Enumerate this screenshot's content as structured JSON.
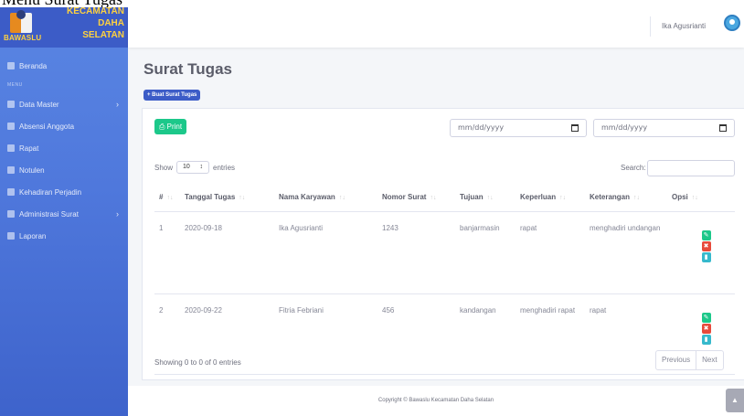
{
  "caption": "Menu Surat Tugas",
  "brand": {
    "line1": "KECAMATAN",
    "line2": "DAHA",
    "line3": "SELATAN",
    "org": "BAWASLU"
  },
  "sidebar": {
    "items": [
      {
        "label": "Beranda"
      },
      {
        "heading": "MENU"
      },
      {
        "label": "Data Master",
        "chevron": "›"
      },
      {
        "label": "Absensi Anggota"
      },
      {
        "label": "Rapat"
      },
      {
        "label": "Notulen"
      },
      {
        "label": "Kehadiran Perjadin"
      },
      {
        "label": "Administrasi Surat",
        "chevron": "›"
      },
      {
        "label": "Laporan"
      }
    ]
  },
  "topbar": {
    "user_name": "Ika Agusrianti"
  },
  "page": {
    "title": "Surat Tugas",
    "create_button": "+ Buat Surat Tugas"
  },
  "toolbar": {
    "print_label": "Print",
    "date_from_placeholder": "mm/dd/yyyy",
    "date_to_placeholder": "mm/dd/yyyy"
  },
  "table_controls": {
    "show_label": "Show",
    "entries_value": "10",
    "entries_label": "entries",
    "search_label": "Search:"
  },
  "table": {
    "headers": [
      "#",
      "Tanggal Tugas",
      "Nama Karyawan",
      "Nomor Surat",
      "Tujuan",
      "Keperluan",
      "Keterangan",
      "Opsi"
    ],
    "rows": [
      {
        "no": "1",
        "tanggal": "2020-09-18",
        "nama": "Ika Agusrianti",
        "nomor": "1243",
        "tujuan": "banjarmasin",
        "keperluan": "rapat",
        "keterangan": "menghadiri undangan"
      },
      {
        "no": "2",
        "tanggal": "2020-09-22",
        "nama": "Fitria Febriani",
        "nomor": "456",
        "tujuan": "kandangan",
        "keperluan": "menghadiri rapat",
        "keterangan": "rapat"
      }
    ]
  },
  "pagination": {
    "info": "Showing 0 to 0 of 0 entries",
    "previous": "Previous",
    "next": "Next"
  },
  "footer": {
    "copyright": "Copyright © Bawaslu Kecamatan Daha Selatan"
  },
  "colors": {
    "sidebar": "#4e73df",
    "primary": "#3c5cc7",
    "success": "#1cc88a",
    "danger": "#e74a3b",
    "info": "#36b9cc"
  }
}
